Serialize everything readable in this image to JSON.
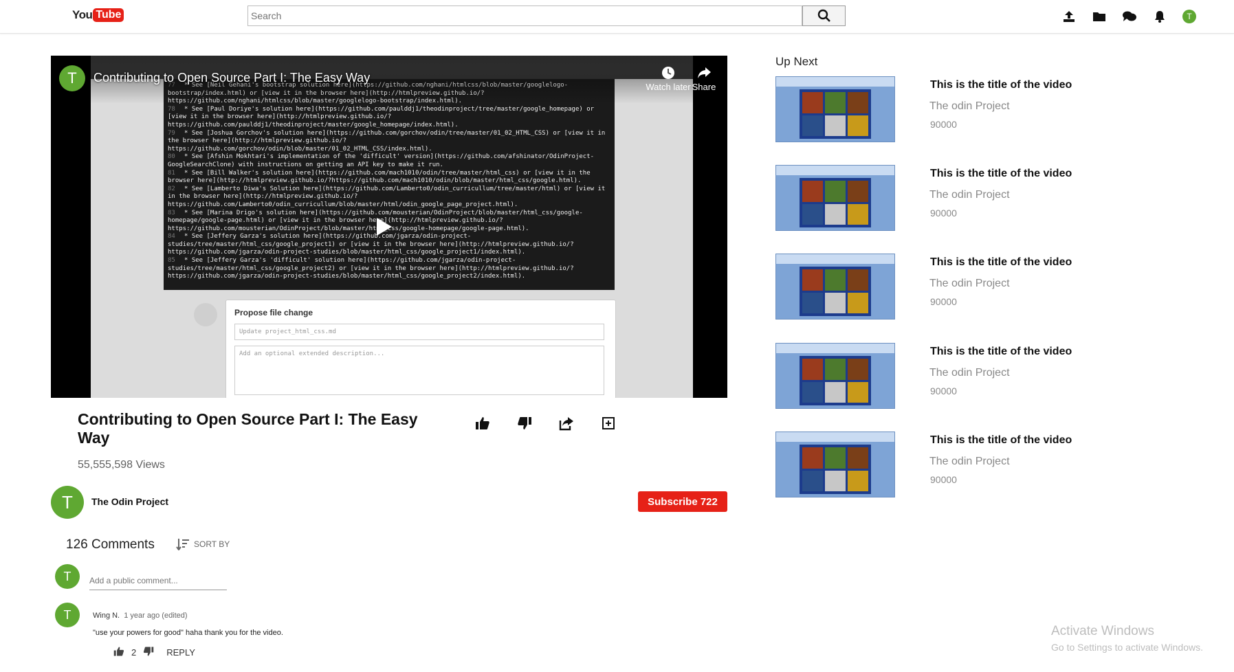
{
  "header": {
    "logo_you": "You",
    "logo_tube": "Tube",
    "search_placeholder": "Search",
    "avatar_letter": "T",
    "icons": [
      "upload-icon",
      "folder-icon",
      "chat-icon",
      "bell-icon",
      "avatar"
    ]
  },
  "player": {
    "overlay_title": "Contributing to Open Source Part I: The Easy Way",
    "channel_letter": "T",
    "watch_later": "Watch later",
    "share": "Share",
    "propose_heading": "Propose file change",
    "propose_field": "Update project_html_css.md",
    "propose_desc": "Add an optional extended description...",
    "code_lines": [
      {
        "n": "77",
        "t": "* See [Neil Gehani's bootstrap solution here](https://github.com/nghani/htmlcss/blob/master/googlelogo-bootstrap/index.html) or [view it in the browser here](http://htmlpreview.github.io/?https://github.com/nghani/htmlcss/blob/master/googlelogo-bootstrap/index.html)."
      },
      {
        "n": "78",
        "t": "* See [Paul Doriye's solution here](https://github.com/paulddj1/theodinproject/tree/master/google_homepage) or [view it in the browser here](http://htmlpreview.github.io/?https://github.com/paulddj1/theodinproject/master/google_homepage/index.html)."
      },
      {
        "n": "79",
        "t": "* See [Joshua Gorchov's solution here](https://github.com/gorchov/odin/tree/master/01_02_HTML_CSS) or [view it in the browser here](http://htmlpreview.github.io/?https://github.com/gorchov/odin/blob/master/01_02_HTML_CSS/index.html)."
      },
      {
        "n": "80",
        "t": "* See [Afshin Mokhtari's implementation of the 'difficult' version](https://github.com/afshinator/OdinProject-GoogleSearchClone) with instructions on getting an API key to make it run."
      },
      {
        "n": "81",
        "t": "* See [Bill Walker's solution here](https://github.com/mach1010/odin/tree/master/html_css) or [view it in the browser here](http://htmlpreview.github.io/?https://github.com/mach1010/odin/blob/master/html_css/google.html)."
      },
      {
        "n": "82",
        "t": "* See [Lamberto Diwa's Solution here](https://github.com/Lamberto0/odin_curricullum/tree/master/html) or [view it in the browser here](http://htmlpreview.github.io/?https://github.com/Lamberto0/odin_curricullum/blob/master/html/odin_google_page_project.html)."
      },
      {
        "n": "83",
        "t": "* See [Marina Drigo's solution here](https://github.com/mousterian/OdinProject/blob/master/html_css/google-homepage/google-page.html) or [view it in the browser here](http://htmlpreview.github.io/?https://github.com/mousterian/OdinProject/blob/master/html_css/google-homepage/google-page.html)."
      },
      {
        "n": "84",
        "t": "* See [Jeffery Garza's solution here](https://github.com/jgarza/odin-project-studies/tree/master/html_css/google_project1) or [view it in the browser here](http://htmlpreview.github.io/?https://github.com/jgarza/odin-project-studies/blob/master/html_css/google_project1/index.html)."
      },
      {
        "n": "85",
        "t": "* See [Jeffery Garza's 'difficult' solution here](https://github.com/jgarza/odin-project-studies/tree/master/html_css/google_project2) or [view it in the browser here](http://htmlpreview.github.io/?https://github.com/jgarza/odin-project-studies/blob/master/html_css/google_project2/index.html)."
      }
    ]
  },
  "video": {
    "title": "Contributing to Open Source Part I: The Easy Way",
    "views": "55,555,598 Views",
    "channel_name": "The Odin Project",
    "channel_letter": "T",
    "subscribe_label": "Subscribe 722"
  },
  "comments": {
    "count_label": "126 Comments",
    "sort_label": "SORT BY",
    "add_placeholder": "Add a public comment...",
    "user_letter": "T",
    "items": [
      {
        "author": "Wing N.",
        "time": "1 year ago (edited)",
        "text": "\"use your powers for good\" haha thank you for the video.",
        "likes": "2",
        "reply_label": "REPLY",
        "letter": "T"
      }
    ]
  },
  "upnext": {
    "heading": "Up Next",
    "items": [
      {
        "title": "This is the title of the video",
        "channel": "The odin Project",
        "views": "90000"
      },
      {
        "title": "This is the title of the video",
        "channel": "The odin Project",
        "views": "90000"
      },
      {
        "title": "This is the title of the video",
        "channel": "The odin Project",
        "views": "90000"
      },
      {
        "title": "This is the title of the video",
        "channel": "The odin Project",
        "views": "90000"
      },
      {
        "title": "This is the title of the video",
        "channel": "The odin Project",
        "views": "90000"
      }
    ]
  },
  "watermark": {
    "line1": "Activate Windows",
    "line2": "Go to Settings to activate Windows."
  },
  "colors": {
    "accent_red": "#e62117",
    "avatar_green": "#5fa832"
  }
}
